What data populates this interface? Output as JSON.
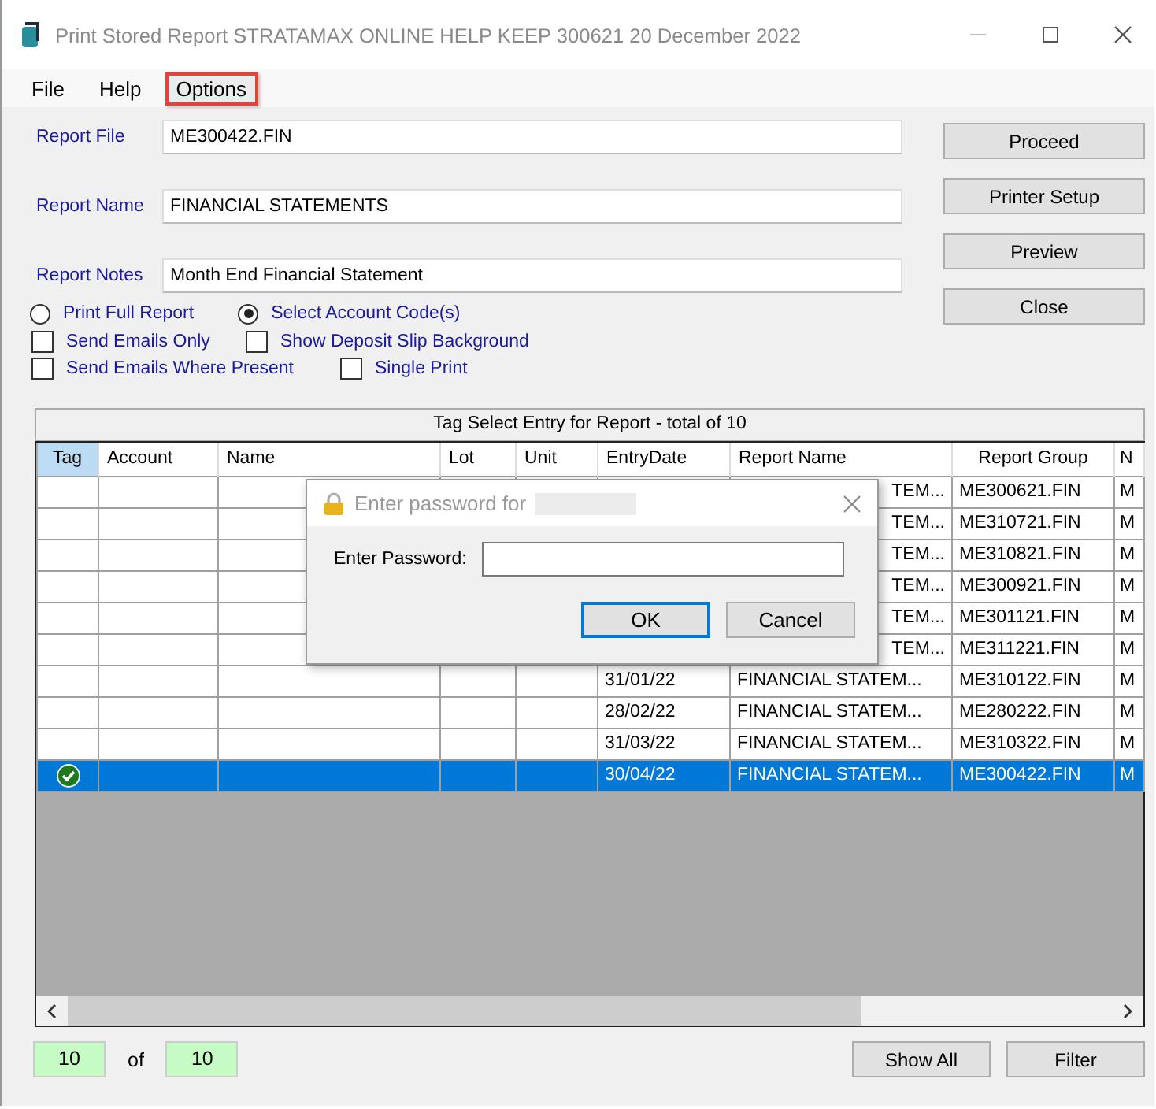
{
  "window": {
    "title": "Print Stored Report STRATAMAX ONLINE HELP KEEP 300621 20 December 2022"
  },
  "menu": [
    {
      "label": "File",
      "highlighted": false
    },
    {
      "label": "Help",
      "highlighted": false
    },
    {
      "label": "Options",
      "highlighted": true
    }
  ],
  "fields": [
    {
      "label": "Report File",
      "value": "ME300422.FIN"
    },
    {
      "label": "Report Name",
      "value": "FINANCIAL STATEMENTS"
    },
    {
      "label": "Report Notes",
      "value": "Month End Financial Statement"
    }
  ],
  "side_buttons": [
    "Proceed",
    "Printer Setup",
    "Preview",
    "Close"
  ],
  "radios": [
    {
      "label": "Print Full Report",
      "selected": false
    },
    {
      "label": "Select Account Code(s)",
      "selected": true
    }
  ],
  "checkboxes": [
    {
      "label": "Send Emails Only",
      "checked": false
    },
    {
      "label": "Show Deposit Slip Background",
      "checked": false
    },
    {
      "label": "Send Emails Where Present",
      "checked": false
    },
    {
      "label": "Single Print",
      "checked": false
    }
  ],
  "table": {
    "caption": "Tag Select Entry for Report - total of 10",
    "columns": [
      {
        "label": "Tag",
        "selected": true
      },
      {
        "label": "Account",
        "selected": false
      },
      {
        "label": "Name",
        "selected": false
      },
      {
        "label": "Lot",
        "selected": false
      },
      {
        "label": "Unit",
        "selected": false
      },
      {
        "label": "EntryDate",
        "selected": false
      },
      {
        "label": "Report Name",
        "selected": false
      },
      {
        "label": "Report Group",
        "selected": false
      },
      {
        "label": "N",
        "selected": false
      }
    ],
    "rows": [
      {
        "tagged": false,
        "selected": false,
        "report_name": "TEM...",
        "report_group": "ME300621.FIN",
        "column_9": "M"
      },
      {
        "tagged": false,
        "selected": false,
        "report_name": "TEM...",
        "report_group": "ME310721.FIN",
        "column_9": "M"
      },
      {
        "tagged": false,
        "selected": false,
        "report_name": "TEM...",
        "report_group": "ME310821.FIN",
        "column_9": "M"
      },
      {
        "tagged": false,
        "selected": false,
        "report_name": "TEM...",
        "report_group": "ME300921.FIN",
        "column_9": "M"
      },
      {
        "tagged": false,
        "selected": false,
        "report_name": "TEM...",
        "report_group": "ME301121.FIN",
        "column_9": "M"
      },
      {
        "tagged": false,
        "selected": false,
        "report_name": "TEM...",
        "report_group": "ME311221.FIN",
        "column_9": "M"
      },
      {
        "tagged": false,
        "selected": false,
        "entry_date": "31/01/22",
        "report_name": "FINANCIAL STATEM...",
        "report_group": "ME310122.FIN",
        "column_9": "M"
      },
      {
        "tagged": false,
        "selected": false,
        "entry_date": "28/02/22",
        "report_name": "FINANCIAL STATEM...",
        "report_group": "ME280222.FIN",
        "column_9": "M"
      },
      {
        "tagged": false,
        "selected": false,
        "entry_date": "31/03/22",
        "report_name": "FINANCIAL STATEM...",
        "report_group": "ME310322.FIN",
        "column_9": "M"
      },
      {
        "tagged": true,
        "selected": true,
        "entry_date": "30/04/22",
        "report_name": "FINANCIAL STATEM...",
        "report_group": "ME300422.FIN",
        "column_9": "M"
      }
    ]
  },
  "counter": {
    "shown": "10",
    "of": "of",
    "total": "10"
  },
  "bottom_buttons": [
    "Show All",
    "Filter"
  ],
  "dialog": {
    "title": "Enter password for",
    "label": "Enter Password:",
    "buttons": [
      {
        "label": "OK",
        "default": true
      },
      {
        "label": "Cancel",
        "default": false
      }
    ]
  }
}
